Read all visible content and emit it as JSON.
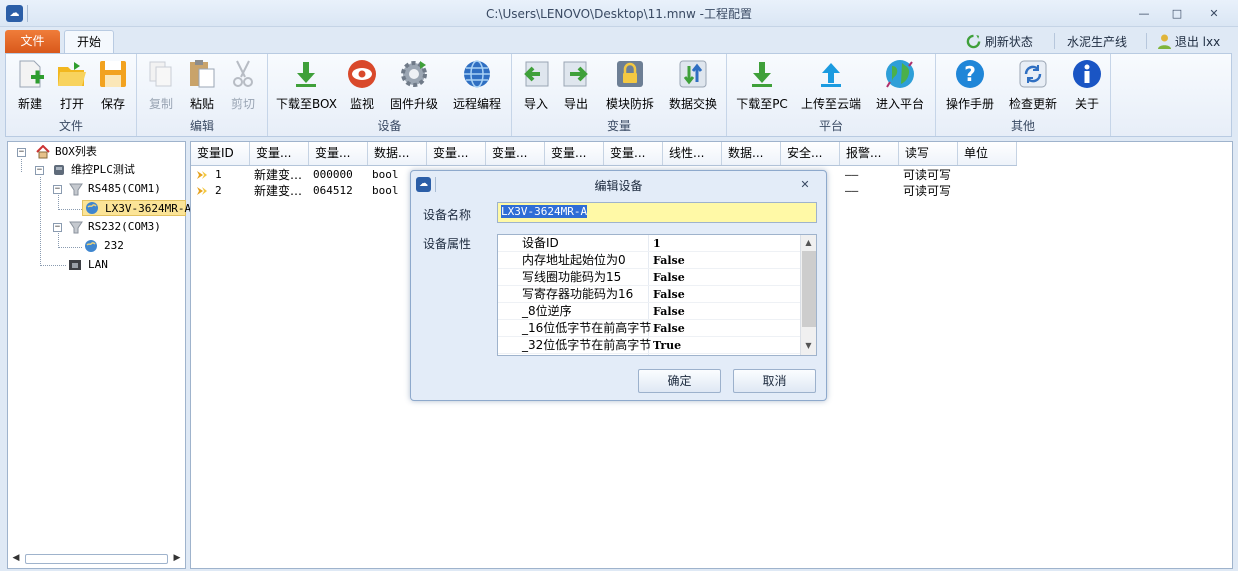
{
  "window": {
    "title": "C:\\Users\\LENOVO\\Desktop\\11.mnw  -工程配置",
    "minimize": "—",
    "restore": "□",
    "close": "✕"
  },
  "tabs": {
    "file": "文件",
    "start": "开始"
  },
  "right_menu": {
    "refresh": "刷新状态",
    "line": "水泥生产线",
    "logout": "退出 lxx"
  },
  "ribbon": {
    "groups": [
      "文件",
      "编辑",
      "设备",
      "变量",
      "平台",
      "其他"
    ],
    "file": {
      "new": "新建",
      "open": "打开",
      "save": "保存"
    },
    "edit": {
      "copy": "复制",
      "paste": "粘贴",
      "cut": "剪切"
    },
    "device": {
      "download_box": "下载至BOX",
      "monitor": "监视",
      "firmware": "固件升级",
      "remote": "远程编程"
    },
    "variable": {
      "import": "导入",
      "export": "导出",
      "module": "模块防拆",
      "exchange": "数据交换"
    },
    "platform": {
      "download_pc": "下载至PC",
      "upload_cloud": "上传至云端",
      "enter_platform": "进入平台"
    },
    "other": {
      "manual": "操作手册",
      "update": "检查更新",
      "about": "关于"
    }
  },
  "tree": {
    "root": "BOX列表",
    "project": "维控PLC测试",
    "rs485": "RS485(COM1)",
    "device1": "LX3V-3624MR-A",
    "rs232": "RS232(COM3)",
    "device2": "232",
    "lan": "LAN",
    "scroll_left": "◀",
    "scroll_right": "▶"
  },
  "table": {
    "headers": [
      "变量ID",
      "变量...",
      "变量...",
      "数据...",
      "变量...",
      "变量...",
      "变量...",
      "变量...",
      "线性...",
      "数据...",
      "安全...",
      "报警...",
      "读写",
      "单位"
    ],
    "rows": [
      {
        "id": "1",
        "name": "新建变…",
        "addr": "000000",
        "type": "bool",
        "alarm": "——",
        "rw": "可读可写"
      },
      {
        "id": "2",
        "name": "新建变…",
        "addr": "064512",
        "type": "bool",
        "alarm": "——",
        "rw": "可读可写"
      }
    ]
  },
  "dialog": {
    "title": "编辑设备",
    "close": "✕",
    "name_label": "设备名称",
    "name_value": "LX3V-3624MR-A",
    "props_label": "设备属性",
    "properties": [
      {
        "name": "设备ID",
        "value": "1"
      },
      {
        "name": "内存地址起始位为0",
        "value": "False"
      },
      {
        "name": "写线圈功能码为15",
        "value": "False"
      },
      {
        "name": "写寄存器功能码为16",
        "value": "False"
      },
      {
        "name": "_8位逆序",
        "value": "False"
      },
      {
        "name": "_16位低字节在前高字节",
        "value": "False"
      },
      {
        "name": "_32位低字节在前高字节",
        "value": "True"
      }
    ],
    "scroll_up": "▲",
    "scroll_down": "▼",
    "ok": "确定",
    "cancel": "取消"
  },
  "colors": {
    "accent": "#2b5ea7",
    "file_tab": "#e3692a",
    "selection": "#fbe497",
    "input_bg": "#fff9a6"
  }
}
